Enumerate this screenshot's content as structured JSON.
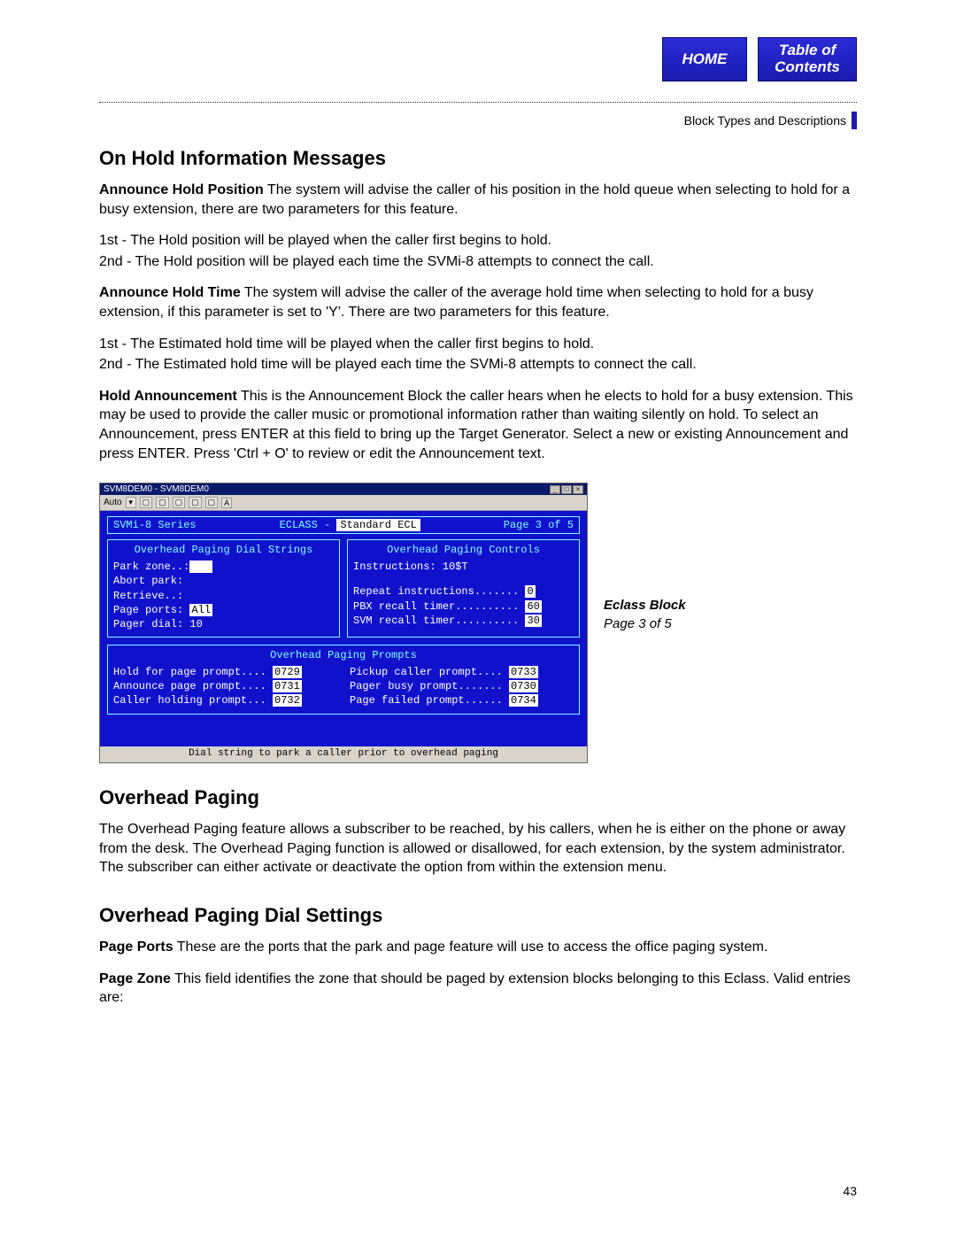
{
  "nav": {
    "home": "HOME",
    "toc_line1": "Table of",
    "toc_line2": "Contents"
  },
  "breadcrumb": "Block Types and Descriptions",
  "sections": {
    "onhold_title": "On Hold Information Messages",
    "announce_hold_position_label": "Announce Hold Position",
    "announce_hold_position_text": "   The system will advise the caller of his position in the hold queue when selecting to hold for a busy extension, there are two parameters for this feature.",
    "hp_1st": "1st - The Hold position will be played when the caller first begins to hold.",
    "hp_2nd": "2nd - The Hold position will be played each time the SVMi-8 attempts to connect the call.",
    "announce_hold_time_label": "Announce  Hold Time",
    "announce_hold_time_text": "   The system will advise the caller of the average hold time when selecting to hold for a busy extension, if this parameter is set to 'Y'. There are two parameters for this feature.",
    "ht_1st": "1st - The Estimated hold time will be played when the caller first begins to hold.",
    "ht_2nd": "2nd - The Estimated hold time will be played each time the SVMi-8 attempts to connect the call.",
    "hold_announce_label": "Hold Announcement",
    "hold_announce_text": "   This is the Announcement Block the caller hears when he elects to hold for a busy extension. This may be used to provide the caller music or promotional information rather than waiting silently on hold.  To select an Announcement, press ENTER at this field to bring up the Target Generator.  Select a new or existing Announcement and press ENTER.  Press 'Ctrl + O'  to review or edit the Announcement text.",
    "overhead_title": "Overhead Paging",
    "overhead_text": "The Overhead Paging feature allows a subscriber to be reached, by his callers, when he is either on the phone or away from the desk.  The Overhead Paging function is allowed or disallowed, for each extension, by the system administrator.  The subscriber can either activate or deactivate the option from within the extension menu.",
    "dial_title": "Overhead Paging Dial Settings",
    "page_ports_label": "Page Ports",
    "page_ports_text": "   These are the ports that the park and page feature will use to access the office paging system.",
    "page_zone_label": "Page Zone",
    "page_zone_text": "   This field identifies the zone that should be paged by extension blocks belonging to this Eclass. Valid entries are:"
  },
  "terminal": {
    "win_title": "SVM8DEM0 - SVM8DEM0",
    "toolbar_label": "Auto",
    "hdr_left": "SVMi-8 Series",
    "hdr_mid_label": "ECLASS - ",
    "hdr_mid_value": "Standard ECL",
    "hdr_right": "Page 3 of 5",
    "left_panel_title": "Overhead Paging Dial Strings",
    "right_panel_title": "Overhead Paging Controls",
    "left_rows": {
      "park_zone": "Park zone..:",
      "abort_park": "Abort park:",
      "retrieve": "Retrieve..:",
      "page_ports_l": "Page ports:",
      "page_ports_v": "All",
      "pager_dial_l": "Pager dial:",
      "pager_dial_v": "10"
    },
    "right_rows": {
      "instructions": "Instructions: 10$T",
      "repeat_l": "Repeat instructions.......",
      "repeat_v": "0",
      "pbx_l": "PBX recall timer..........",
      "pbx_v": "60",
      "svm_l": "SVM recall timer..........",
      "svm_v": "30"
    },
    "prompts_title": "Overhead Paging Prompts",
    "prompts_left": [
      {
        "l": "Hold for page prompt....",
        "v": "0729"
      },
      {
        "l": "Announce page prompt....",
        "v": "0731"
      },
      {
        "l": "Caller holding prompt...",
        "v": "0732"
      }
    ],
    "prompts_right": [
      {
        "l": "Pickup caller prompt....",
        "v": "0733"
      },
      {
        "l": "Pager busy prompt.......",
        "v": "0730"
      },
      {
        "l": "Page failed prompt......",
        "v": "0734"
      }
    ],
    "footer": "Dial string to park a caller prior to overhead paging"
  },
  "side_label": {
    "title": "Eclass Block",
    "page": "Page 3 of 5"
  },
  "page_number": "43"
}
